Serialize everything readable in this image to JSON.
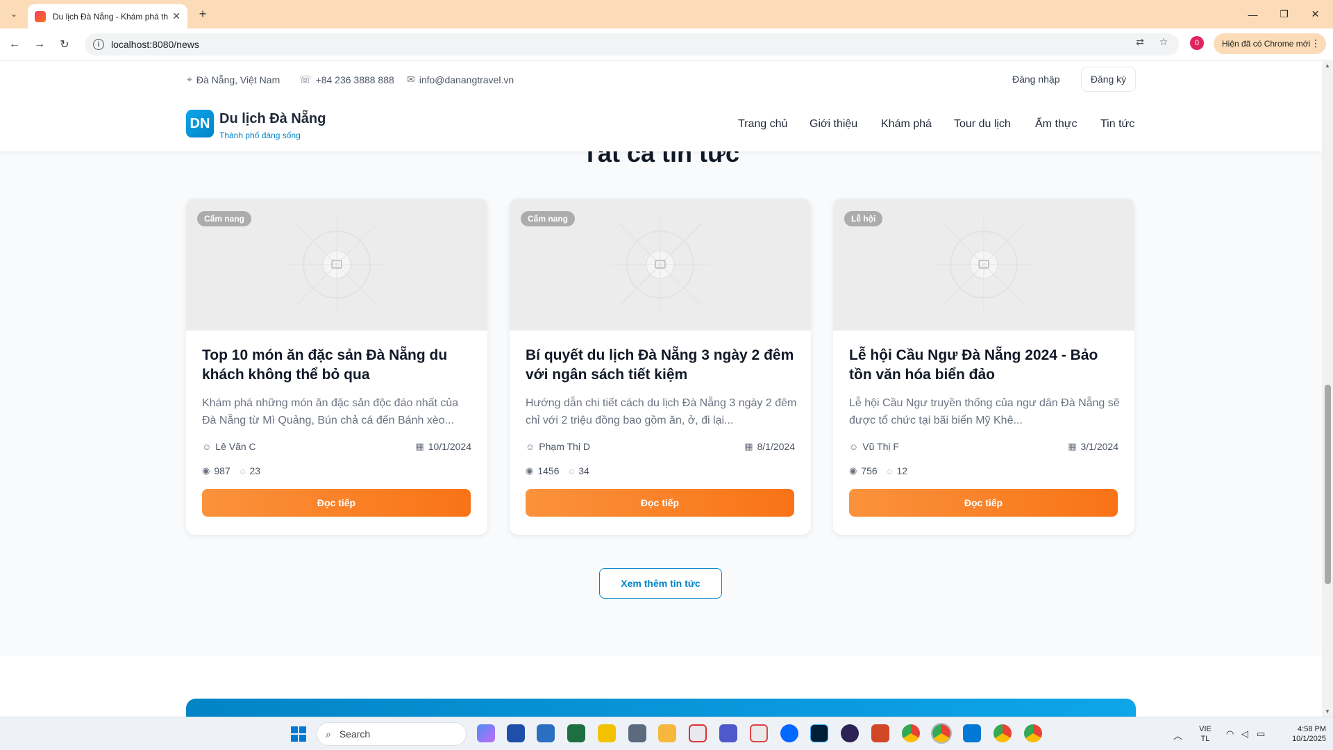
{
  "browser": {
    "tab_title": "Du lịch Đà Nẵng - Khám phá th",
    "url": "localhost:8080/news",
    "profile_badge": "0",
    "chrome_new_label": "Hiện đã có Chrome mới"
  },
  "topbar": {
    "location": "Đà Nẵng, Việt Nam",
    "phone": "+84 236 3888 888",
    "email": "info@danangtravel.vn",
    "login": "Đăng nhập",
    "register": "Đăng ký"
  },
  "brand": {
    "logo_text": "DN",
    "name": "Du lịch Đà Nẵng",
    "tagline": "Thành phố đáng sống"
  },
  "nav": [
    "Trang chủ",
    "Giới thiệu",
    "Khám phá",
    "Tour du lịch",
    "Ẩm thực",
    "Tin tức"
  ],
  "section_title": "Tất cả tin tức",
  "cards": [
    {
      "badge": "Cẩm nang",
      "title": "Top 10 món ăn đặc sản Đà Nẵng du khách không thể bỏ qua",
      "desc": "Khám phá những món ăn đặc sản độc đáo nhất của Đà Nẵng từ Mì Quảng, Bún chả cá đến Bánh xèo...",
      "author": "Lê Văn C",
      "date": "10/1/2024",
      "views": "987",
      "comments": "23",
      "cta": "Đọc tiếp"
    },
    {
      "badge": "Cẩm nang",
      "title": "Bí quyết du lịch Đà Nẵng 3 ngày 2 đêm với ngân sách tiết kiệm",
      "desc": "Hướng dẫn chi tiết cách du lịch Đà Nẵng 3 ngày 2 đêm chỉ với 2 triệu đồng bao gồm ăn, ở, đi lại...",
      "author": "Phạm Thị D",
      "date": "8/1/2024",
      "views": "1456",
      "comments": "34",
      "cta": "Đọc tiếp"
    },
    {
      "badge": "Lễ hội",
      "title": "Lễ hội Cầu Ngư Đà Nẵng 2024 - Bảo tồn văn hóa biển đảo",
      "desc": "Lễ hội Cầu Ngư truyền thống của ngư dân Đà Nẵng sẽ được tổ chức tại bãi biển Mỹ Khê...",
      "author": "Vũ Thị F",
      "date": "3/1/2024",
      "views": "756",
      "comments": "12",
      "cta": "Đọc tiếp"
    }
  ],
  "more_button": "Xem thêm tin tức",
  "taskbar": {
    "search_placeholder": "Search",
    "lang_top": "VIE",
    "lang_bottom": "TL",
    "time": "4:58 PM",
    "date": "10/1/2025"
  },
  "colors": {
    "accent_orange": "#f97316",
    "accent_blue": "#0284c7",
    "chrome_tabbar": "#fcdcb8"
  }
}
